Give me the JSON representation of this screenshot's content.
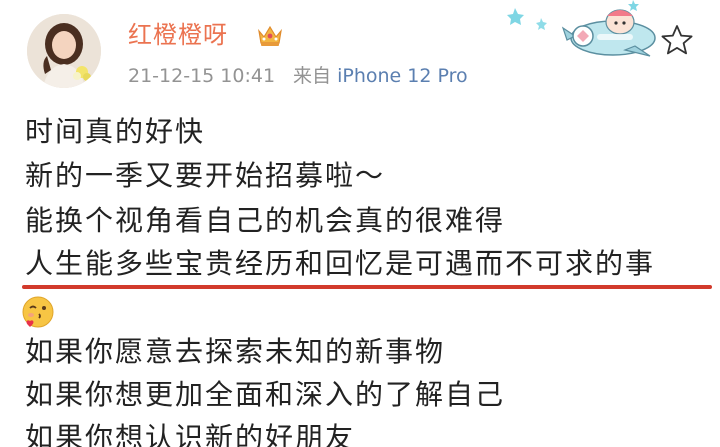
{
  "post": {
    "author": {
      "name": "红橙橙呀",
      "badge_icon": "crown-icon",
      "avatar_icon": "avatar"
    },
    "meta": {
      "time": "21-12-15 10:41",
      "source_prefix": "来自",
      "source": "iPhone 12 Pro"
    },
    "decoration_icon": "cartoon-airplane-decoration",
    "favorite_icon": "star-outline-icon",
    "highlight_color": "#d23a2c",
    "name_color": "#eb7350",
    "lines": [
      "时间真的好快",
      "新的一季又要开始招募啦～",
      "能换个视角看自己的机会真的很难得",
      "人生能多些宝贵经历和回忆是可遇而不可求的事",
      "如果你愿意去探索未知的新事物",
      "如果你想更加全面和深入的了解自己",
      "如果你想认识新的好朋友"
    ],
    "emoji_icon": "blowing-kiss-emoji"
  }
}
